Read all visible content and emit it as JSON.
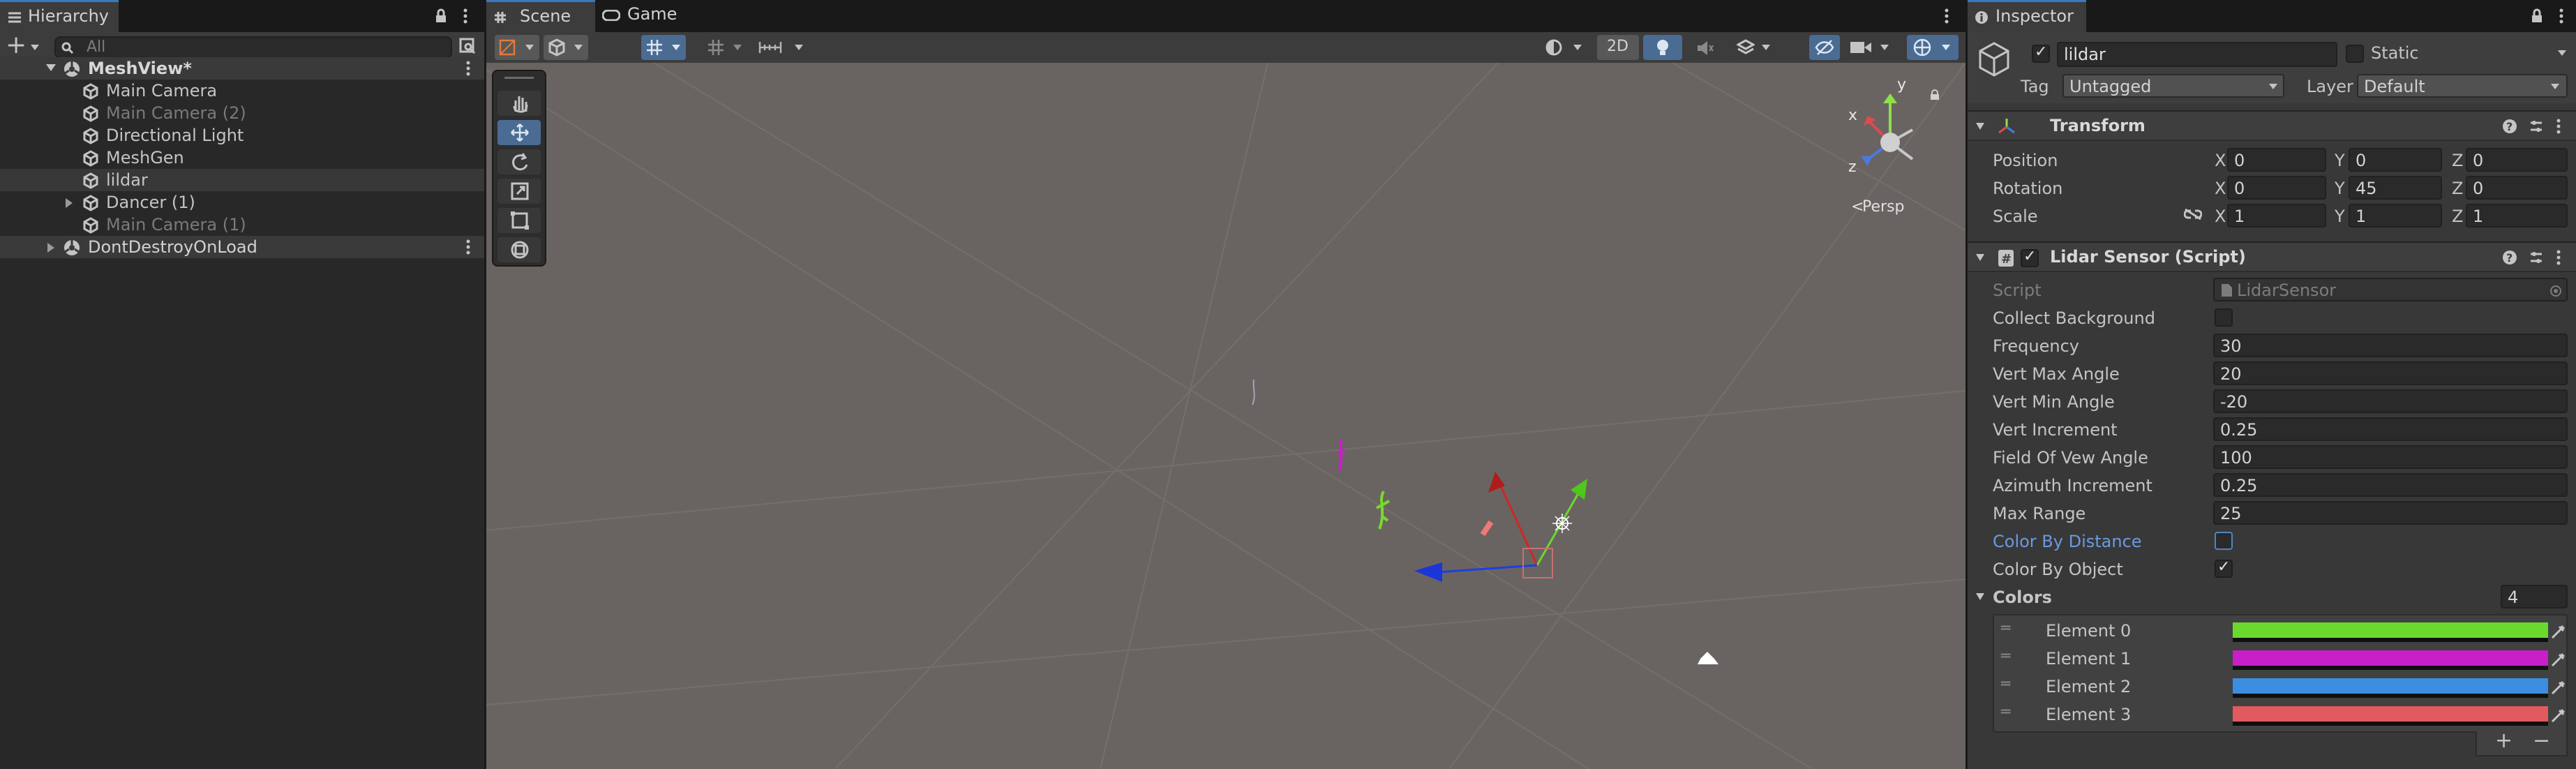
{
  "hierarchy": {
    "tab_title": "Hierarchy",
    "search_placeholder": "All",
    "add_label": "+",
    "scene_name": "MeshView*",
    "items": [
      {
        "label": "Main Camera",
        "dim": false
      },
      {
        "label": "Main Camera (2)",
        "dim": true
      },
      {
        "label": "Directional Light",
        "dim": false
      },
      {
        "label": "MeshGen",
        "dim": false
      },
      {
        "label": "lildar",
        "dim": false,
        "selected": true
      },
      {
        "label": "Dancer (1)",
        "dim": false,
        "expandable": true
      },
      {
        "label": "Main Camera (1)",
        "dim": true
      }
    ],
    "dont_destroy": "DontDestroyOnLoad"
  },
  "scene_view": {
    "tabs": [
      {
        "label": "Scene",
        "icon": "grid-icon"
      },
      {
        "label": "Game",
        "icon": "gamepad-icon"
      }
    ],
    "toggle_2d": "2D",
    "persp_label": "Persp",
    "gizmo_axes": {
      "x": "x",
      "y": "y",
      "z": "z"
    },
    "tools": [
      "hand-tool",
      "move-tool",
      "rotate-tool",
      "scale-tool",
      "rect-tool",
      "transform-tool"
    ],
    "background": "#696461"
  },
  "inspector": {
    "tab_title": "Inspector",
    "object_name": "lildar",
    "static_label": "Static",
    "tag_label": "Tag",
    "tag_value": "Untagged",
    "layer_label": "Layer",
    "layer_value": "Default",
    "transform": {
      "title": "Transform",
      "position_label": "Position",
      "rotation_label": "Rotation",
      "scale_label": "Scale",
      "axis_x": "X",
      "axis_y": "Y",
      "axis_z": "Z",
      "position": {
        "x": "0",
        "y": "0",
        "z": "0"
      },
      "rotation": {
        "x": "0",
        "y": "45",
        "z": "0"
      },
      "scale": {
        "x": "1",
        "y": "1",
        "z": "1"
      }
    },
    "lidar": {
      "title": "Lidar Sensor (Script)",
      "script_label": "Script",
      "script_value": "LidarSensor",
      "collect_background_label": "Collect Background",
      "frequency_label": "Frequency",
      "frequency": "30",
      "vert_max_label": "Vert Max Angle",
      "vert_max": "20",
      "vert_min_label": "Vert Min Angle",
      "vert_min": "-20",
      "vert_inc_label": "Vert Increment",
      "vert_inc": "0.25",
      "fov_label": "Field Of Vew Angle",
      "fov": "100",
      "az_inc_label": "Azimuth Increment",
      "az_inc": "0.25",
      "max_range_label": "Max Range",
      "max_range": "25",
      "color_by_distance_label": "Color By Distance",
      "color_by_object_label": "Color By Object",
      "colors_label": "Colors",
      "colors_count": "4",
      "elements": [
        {
          "label": "Element 0",
          "color": "#6bd82d"
        },
        {
          "label": "Element 1",
          "color": "#c81fc8"
        },
        {
          "label": "Element 2",
          "color": "#3b8ee0"
        },
        {
          "label": "Element 3",
          "color": "#e05a5e"
        }
      ],
      "add_label": "+",
      "remove_label": "−"
    }
  },
  "colors": {
    "accent": "#3a79bb",
    "link": "#6a9ae0"
  }
}
